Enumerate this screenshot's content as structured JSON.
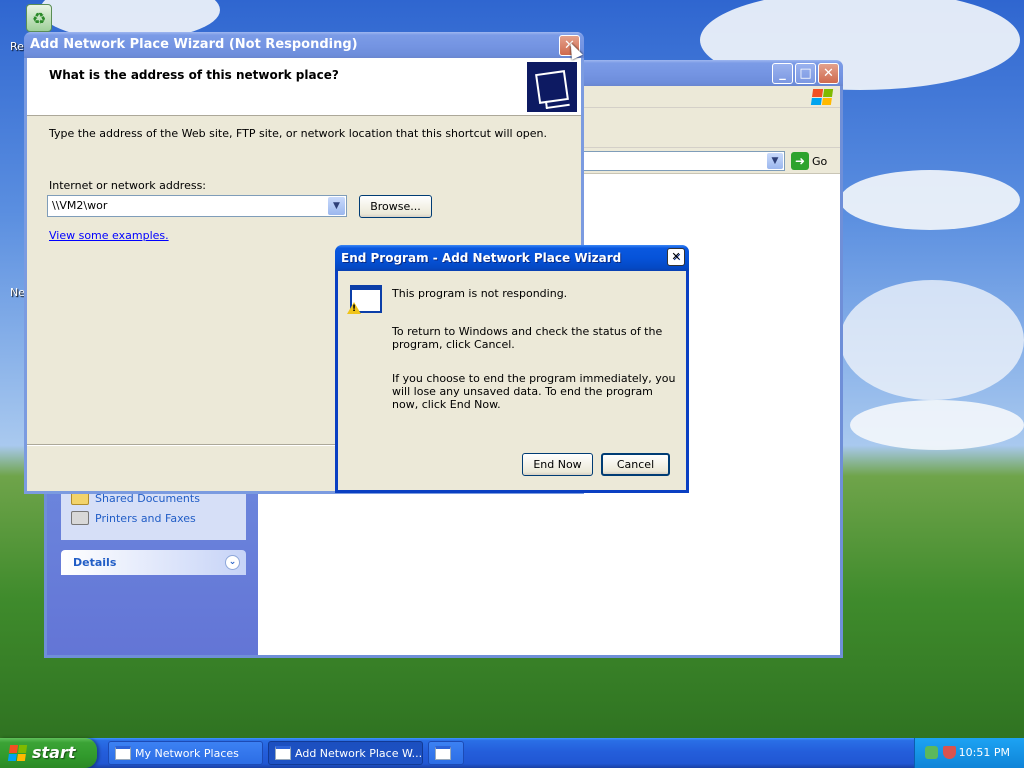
{
  "desktop": {
    "icons": [
      {
        "name": "recycle-bin-icon",
        "label_fragment": "Re"
      },
      {
        "name": "network-icon",
        "label_fragment": "Ne"
      }
    ]
  },
  "explorer": {
    "title": "My Network Places",
    "address_go_label": "Go",
    "task_links": [
      "Shared Documents",
      "Printers and Faxes"
    ],
    "details_label": "Details"
  },
  "wizard": {
    "title": "Add Network Place Wizard (Not Responding)",
    "heading": "What is the address of this network place?",
    "description": "Type the address of the Web site, FTP site, or network location that this shortcut will open.",
    "address_label": "Internet or network address:",
    "address_value": "\\\\VM2\\wor",
    "browse_label": "Browse...",
    "examples_link": "View some examples."
  },
  "end_program": {
    "title": "End Program - Add Network Place Wizard",
    "line1": "This program is not responding.",
    "line2": "To return to Windows and check the status of the program, click Cancel.",
    "line3": "If you choose to end the program immediately, you will lose any unsaved data. To end the program now, click End Now.",
    "end_now_label": "End Now",
    "cancel_label": "Cancel"
  },
  "taskbar": {
    "start_label": "start",
    "items": [
      {
        "label": "My Network Places",
        "active": false
      },
      {
        "label": "Add Network Place W...",
        "active": true
      },
      {
        "label": "",
        "active": false
      }
    ],
    "clock": "10:51 PM"
  }
}
